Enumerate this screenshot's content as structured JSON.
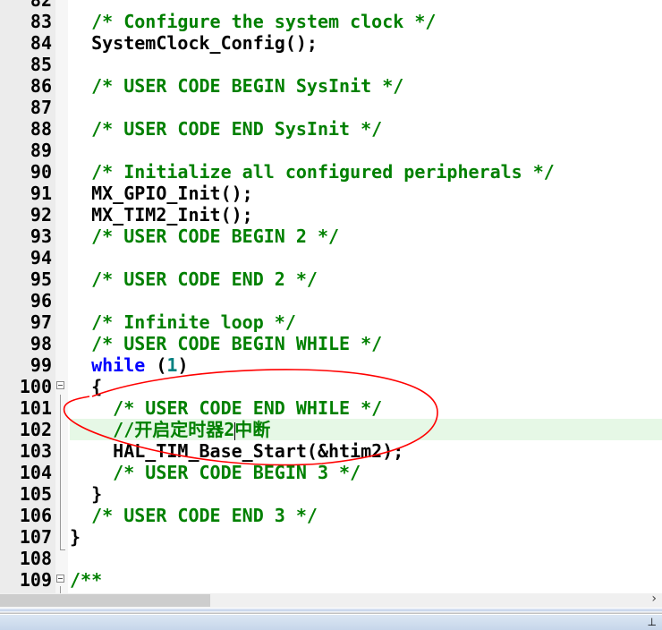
{
  "editor": {
    "lines": [
      {
        "n": "82",
        "segs": []
      },
      {
        "n": "83",
        "segs": [
          [
            "comment",
            "  /* Configure the system clock */"
          ]
        ]
      },
      {
        "n": "84",
        "segs": [
          [
            "plain",
            "  SystemClock_Config();"
          ]
        ]
      },
      {
        "n": "85",
        "segs": []
      },
      {
        "n": "86",
        "segs": [
          [
            "comment",
            "  /* USER CODE BEGIN SysInit */"
          ]
        ]
      },
      {
        "n": "87",
        "segs": []
      },
      {
        "n": "88",
        "segs": [
          [
            "comment",
            "  /* USER CODE END SysInit */"
          ]
        ]
      },
      {
        "n": "89",
        "segs": []
      },
      {
        "n": "90",
        "segs": [
          [
            "comment",
            "  /* Initialize all configured peripherals */"
          ]
        ]
      },
      {
        "n": "91",
        "segs": [
          [
            "plain",
            "  MX_GPIO_Init();"
          ]
        ]
      },
      {
        "n": "92",
        "segs": [
          [
            "plain",
            "  MX_TIM2_Init();"
          ]
        ]
      },
      {
        "n": "93",
        "segs": [
          [
            "comment",
            "  /* USER CODE BEGIN 2 */"
          ]
        ]
      },
      {
        "n": "94",
        "segs": []
      },
      {
        "n": "95",
        "segs": [
          [
            "comment",
            "  /* USER CODE END 2 */"
          ]
        ]
      },
      {
        "n": "96",
        "segs": []
      },
      {
        "n": "97",
        "segs": [
          [
            "comment",
            "  /* Infinite loop */"
          ]
        ]
      },
      {
        "n": "98",
        "segs": [
          [
            "comment",
            "  /* USER CODE BEGIN WHILE */"
          ]
        ]
      },
      {
        "n": "99",
        "segs": [
          [
            "keyword",
            "  while"
          ],
          [
            "plain",
            " ("
          ],
          [
            "number",
            "1"
          ],
          [
            "plain",
            ")"
          ]
        ]
      },
      {
        "n": "100",
        "segs": [
          [
            "plain",
            "  {"
          ]
        ],
        "fold": true
      },
      {
        "n": "101",
        "segs": [
          [
            "comment",
            "    /* USER CODE END WHILE */"
          ]
        ]
      },
      {
        "n": "102",
        "segs": [
          [
            "comment",
            "    //开启定时器2"
          ],
          [
            "caret",
            ""
          ],
          [
            "comment",
            "中断"
          ]
        ],
        "highlight": true
      },
      {
        "n": "103",
        "segs": [
          [
            "plain",
            "    HAL_TIM_Base_Start(&htim2);"
          ]
        ]
      },
      {
        "n": "104",
        "segs": [
          [
            "comment",
            "    /* USER CODE BEGIN 3 */"
          ]
        ]
      },
      {
        "n": "105",
        "segs": [
          [
            "plain",
            "  }"
          ]
        ]
      },
      {
        "n": "106",
        "segs": [
          [
            "comment",
            "  /* USER CODE END 3 */"
          ]
        ]
      },
      {
        "n": "107",
        "segs": [
          [
            "plain",
            "}"
          ]
        ]
      },
      {
        "n": "108",
        "segs": []
      },
      {
        "n": "109",
        "segs": [
          [
            "comment",
            "/**"
          ]
        ],
        "fold": true
      }
    ]
  },
  "colors": {
    "comment": "#008000",
    "keyword": "#0000ff",
    "number": "#008080",
    "annotation": "#ff0000",
    "highlight": "#e6f8e6"
  },
  "icons": {
    "scroll_right": "chevron-right-icon",
    "pin": "pin-icon"
  },
  "statusbar": {
    "pin_glyph": "⊥"
  }
}
